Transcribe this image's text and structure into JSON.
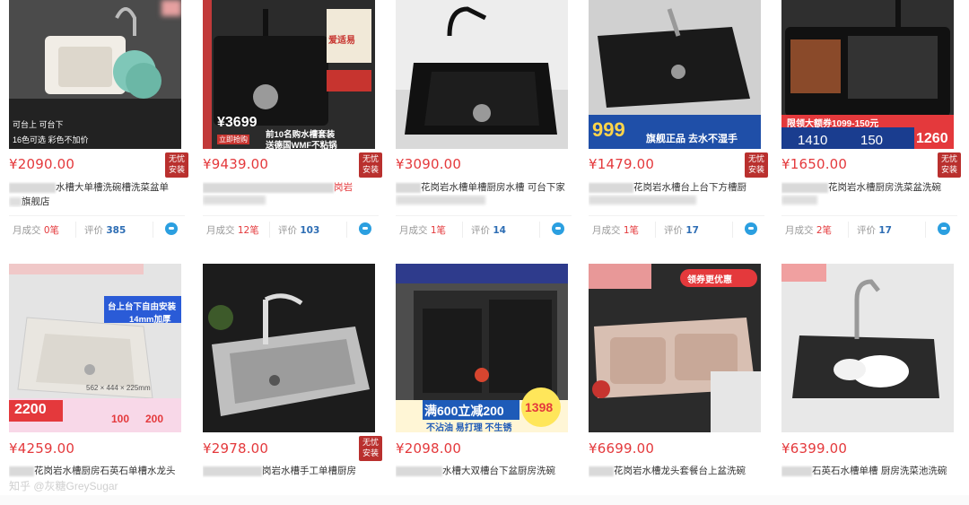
{
  "products": [
    {
      "price": "¥2090.00",
      "badge": "无忧\n安装",
      "title_pre": "",
      "title": "水槽大单槽洗碗槽洗菜盆单",
      "title2": "旗舰店",
      "sold_label": "月成交",
      "sold": "0笔",
      "review_label": "评价",
      "reviews": "385",
      "overlay": [
        "可台上 可台下",
        "16色可选 彩色不加价"
      ]
    },
    {
      "price": "¥9439.00",
      "badge": "无忧\n安装",
      "title_pre": "",
      "title": "岗岩",
      "title2": "",
      "sold_label": "月成交",
      "sold": "12笔",
      "review_label": "评价",
      "reviews": "103",
      "overlay": [
        "¥3699",
        "前10名购水槽套装",
        "送德国WMF不粘锅",
        "爱适易",
        "立即抢购"
      ]
    },
    {
      "price": "¥3090.00",
      "badge": "",
      "title_pre": "",
      "title": "花岗岩水槽单槽厨房水槽 可台下家",
      "title2": "",
      "sold_label": "月成交",
      "sold": "1笔",
      "review_label": "评价",
      "reviews": "14",
      "overlay": []
    },
    {
      "price": "¥1479.00",
      "badge": "无忧\n安装",
      "title_pre": "",
      "title": "花岗岩水槽台上台下方槽厨",
      "title2": "",
      "sold_label": "月成交",
      "sold": "1笔",
      "review_label": "评价",
      "reviews": "17",
      "overlay": [
        "999",
        "旗舰正品 去水不湿手"
      ]
    },
    {
      "price": "¥1650.00",
      "badge": "无忧\n安装",
      "title_pre": "",
      "title": "花岗岩水槽厨房洗菜盆洗碗",
      "title2": "",
      "sold_label": "月成交",
      "sold": "2笔",
      "review_label": "评价",
      "reviews": "17",
      "overlay": [
        "限领大额券1099-150元",
        "1410",
        "150",
        "1260"
      ]
    },
    {
      "price": "¥4259.00",
      "badge": "",
      "title_pre": "",
      "title": "花岗岩水槽厨房石英石单槽水龙头",
      "title2": "",
      "sold_label": "",
      "sold": "",
      "review_label": "",
      "reviews": "",
      "overlay": [
        "台上台下自由安装",
        "14mm加厚",
        "2200",
        "100",
        "200",
        "562 × 444 × 225mm"
      ]
    },
    {
      "price": "¥2978.00",
      "badge": "无忧\n安装",
      "title_pre": "",
      "title": "岗岩水槽手工单槽厨房",
      "title2": "",
      "sold_label": "",
      "sold": "",
      "review_label": "",
      "reviews": "",
      "overlay": []
    },
    {
      "price": "¥2098.00",
      "badge": "",
      "title_pre": "",
      "title": "水槽大双槽台下盆厨房洗碗",
      "title2": "",
      "sold_label": "",
      "sold": "",
      "review_label": "",
      "reviews": "",
      "overlay": [
        "满600立减200",
        "1398",
        "不沾油 易打理 不生锈"
      ]
    },
    {
      "price": "¥6699.00",
      "badge": "",
      "title_pre": "",
      "title": "花岗岩水槽龙头套餐台上盆洗碗",
      "title2": "",
      "sold_label": "",
      "sold": "",
      "review_label": "",
      "reviews": "",
      "overlay": [
        "领券更优惠"
      ]
    },
    {
      "price": "¥6399.00",
      "badge": "",
      "title_pre": "",
      "title": "石英石水槽单槽 厨房洗菜池洗碗",
      "title2": "",
      "sold_label": "",
      "sold": "",
      "review_label": "",
      "reviews": "",
      "overlay": []
    }
  ],
  "watermark": "知乎 @灰糖GreySugar",
  "colors": {
    "price": "#e4393c",
    "badge": "#b9302e",
    "link_blue": "#2d6db4",
    "wangwang": "#2b9fe0"
  }
}
